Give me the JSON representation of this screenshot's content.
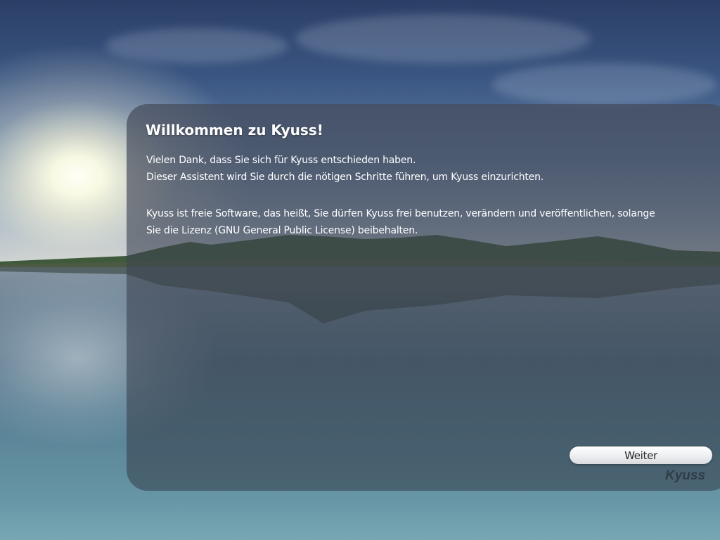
{
  "colors": {
    "panel_background": "#464c5c",
    "text": "#ffffff",
    "button_background": "#eceef0",
    "button_text": "#2a2a2a",
    "brand_text": "#232d37"
  },
  "background": {
    "description_icon": "lake-landscape-wallpaper"
  },
  "welcome": {
    "title": "Willkommen zu Kyuss!",
    "paragraph1_line1": "Vielen Dank, dass Sie sich für Kyuss entschieden haben.",
    "paragraph1_line2": "Dieser Assistent wird Sie durch die nötigen Schritte führen, um Kyuss einzurichten.",
    "paragraph2_line1": "Kyuss ist freie Software, das heißt, Sie dürfen Kyuss frei benutzen, verändern und veröffentlichen, solange",
    "paragraph2_line2": "Sie die Lizenz (GNU General Public License) beibehalten."
  },
  "actions": {
    "next_label": "Weiter"
  },
  "brand": {
    "name": "Kyuss"
  }
}
